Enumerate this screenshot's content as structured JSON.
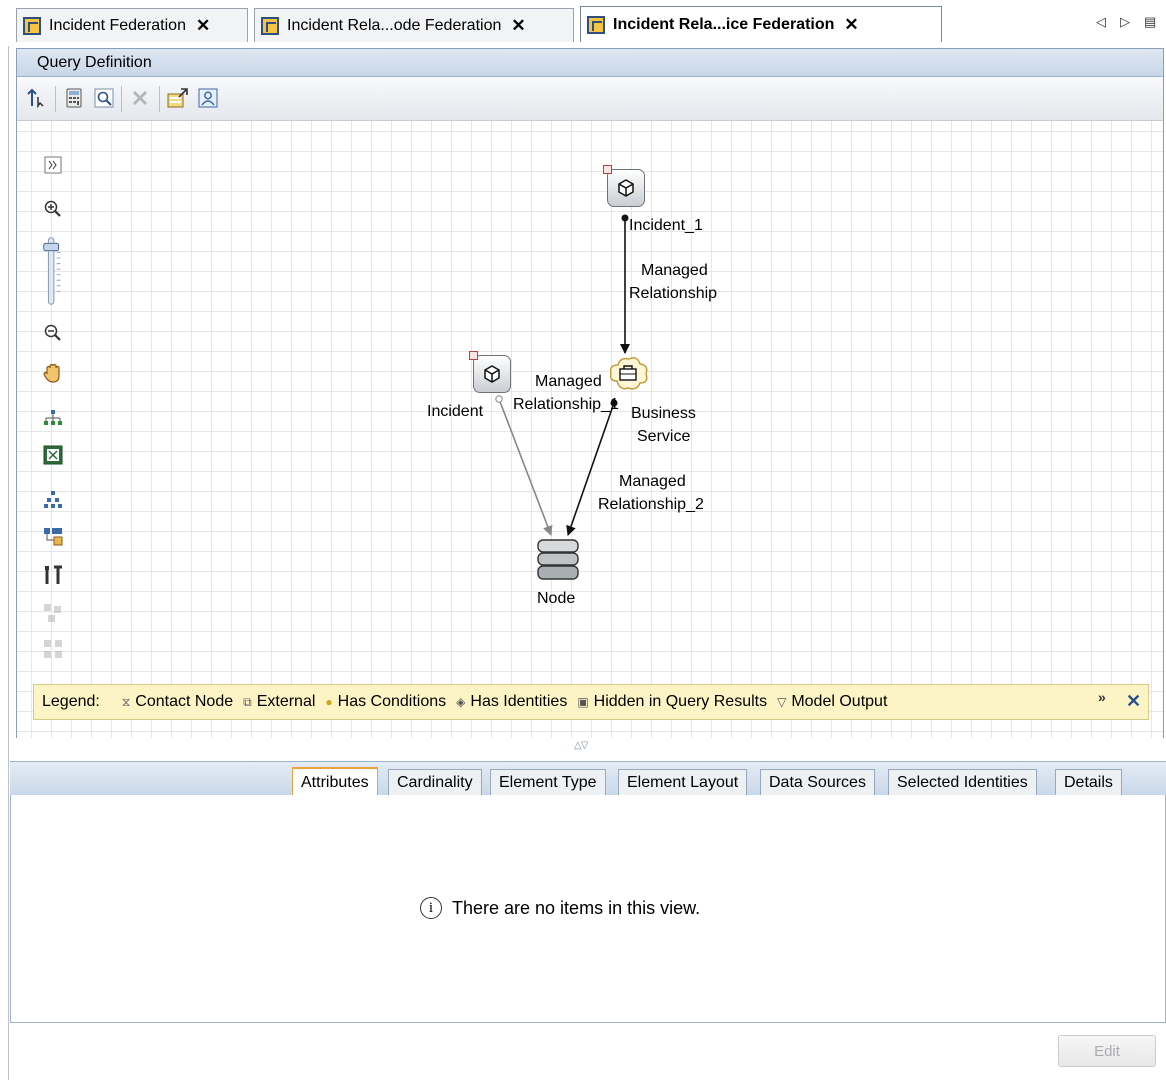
{
  "tabs": [
    {
      "label": "Incident Federation",
      "active": false
    },
    {
      "label": "Incident Rela...ode Federation",
      "active": false
    },
    {
      "label": "Incident Rela...ice Federation",
      "active": true
    }
  ],
  "query_definition": {
    "title": "Query Definition",
    "toolbar_icons": [
      "pointer-icon",
      "calculator-icon",
      "find-icon",
      "delete-icon",
      "properties-icon",
      "identity-icon"
    ],
    "canvas_tools": [
      "expand-icon",
      "zoom-in-icon",
      "zoom-slider",
      "zoom-out-icon",
      "pan-hand-icon",
      "hierarchy-layout-icon",
      "fit-to-window-icon",
      "tree-layout-icon",
      "layout-settings-icon",
      "tools-icon",
      "group-icon",
      "ungroup-icon"
    ]
  },
  "graph": {
    "nodes": {
      "incident_1": {
        "label": "Incident_1",
        "icon": "cube-icon"
      },
      "incident": {
        "label": "Incident",
        "icon": "cube-icon"
      },
      "business_service": {
        "label_line1": "Business",
        "label_line2": "Service",
        "icon": "business-service-icon"
      },
      "node": {
        "label": "Node",
        "icon": "server-icon"
      }
    },
    "edges": {
      "e1": {
        "line1": "Managed",
        "line2": "Relationship"
      },
      "e2": {
        "line1": "Managed",
        "line2": "Relationship_1"
      },
      "e3": {
        "line1": "Managed",
        "line2": "Relationship_2"
      }
    }
  },
  "legend": {
    "title": "Legend:",
    "items": [
      "Contact Node",
      "External",
      "Has Conditions",
      "Has Identities",
      "Hidden in Query Results",
      "Model Output"
    ]
  },
  "bottom_tabs": [
    {
      "label": "Attributes",
      "active": true
    },
    {
      "label": "Cardinality",
      "active": false
    },
    {
      "label": "Element Type",
      "active": false
    },
    {
      "label": "Element Layout",
      "active": false
    },
    {
      "label": "Data Sources",
      "active": false
    },
    {
      "label": "Selected Identities",
      "active": false
    },
    {
      "label": "Details",
      "active": false
    }
  ],
  "empty_message": "There are no items in this view.",
  "info_glyph": "i",
  "edit_button": {
    "label": "Edit",
    "enabled": false
  },
  "close_glyph": "✕",
  "overflow_glyph": "»",
  "colors": {
    "accent_tab": "#f0a23a",
    "header_blue": "#c7d6e8",
    "legend_bg": "#fdf4c6"
  }
}
